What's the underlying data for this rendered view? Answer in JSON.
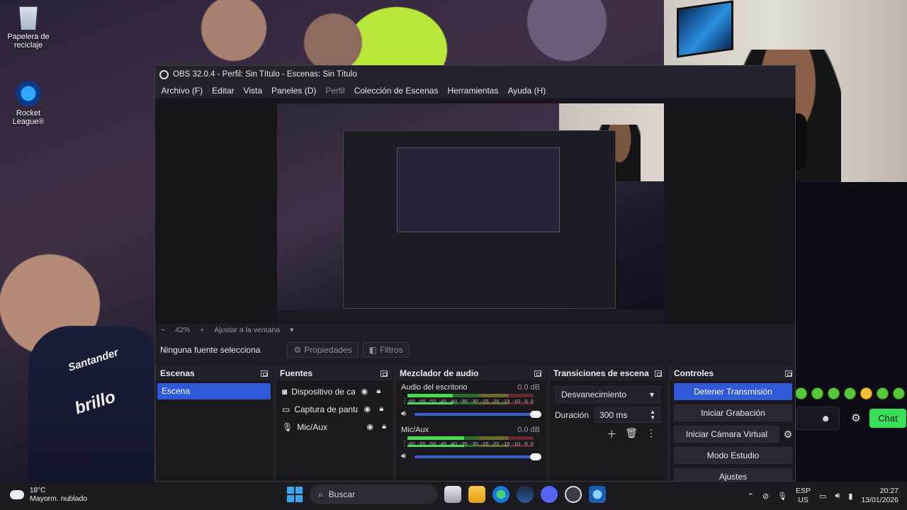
{
  "desktop": {
    "icons": [
      {
        "label": "Papelera de reciclaje"
      },
      {
        "label": "Rocket League®"
      }
    ],
    "jersey_text": [
      "Santander",
      "brillo"
    ]
  },
  "chat": {
    "button_label": "Chat",
    "emotes": [
      "green",
      "green",
      "green",
      "green",
      "yellow",
      "green",
      "green"
    ]
  },
  "obs": {
    "title": "OBS 32.0.4 - Perfil: Sin Título - Escenas: Sin Título",
    "menu": [
      "Archivo (F)",
      "Editar",
      "Vista",
      "Paneles (D)",
      "Perfil",
      "Colección de Escenas",
      "Herramientas",
      "Ayuda (H)"
    ],
    "zoom": {
      "minus": "−",
      "level": "42%",
      "plus": "+",
      "fit_label": "Ajustar a la ventana"
    },
    "source_toolbar": {
      "no_source": "Ninguna fuente selecciona",
      "properties": "Propiedades",
      "filters": "Filtros"
    },
    "docks": {
      "scenes": {
        "title": "Escenas",
        "items": [
          "Escena"
        ]
      },
      "sources": {
        "title": "Fuentes",
        "items": [
          "Dispositivo de cap",
          "Captura de panta",
          "Mic/Aux"
        ]
      },
      "mixer": {
        "title": "Mezclador de audio",
        "scale": [
          "-60",
          "-55",
          "-50",
          "-45",
          "-40",
          "-35",
          "-30",
          "-25",
          "-20",
          "-15",
          "-10",
          "-5",
          "0"
        ],
        "channels": [
          {
            "name": "Audio del escritorio",
            "db": "0.0 dB",
            "level": 0.36
          },
          {
            "name": "Mic/Aux",
            "db": "0.0 dB",
            "level": 0.45
          }
        ]
      },
      "transitions": {
        "title": "Transiciones de escena",
        "selected": "Desvanecimiento",
        "duration_label": "Duración",
        "duration_value": "300 ms"
      },
      "controls": {
        "title": "Controles",
        "buttons": [
          "Detener Transmisión",
          "Iniciar Grabación",
          "Iniciar Cámara Virtual",
          "Modo Estudio",
          "Ajustes"
        ]
      }
    }
  },
  "taskbar": {
    "weather": {
      "temp": "18°C",
      "desc": "Mayorm. nublado"
    },
    "search_placeholder": "Buscar",
    "lang": [
      "ESP",
      "US"
    ],
    "time": "20:27",
    "date": "13/01/2026"
  }
}
